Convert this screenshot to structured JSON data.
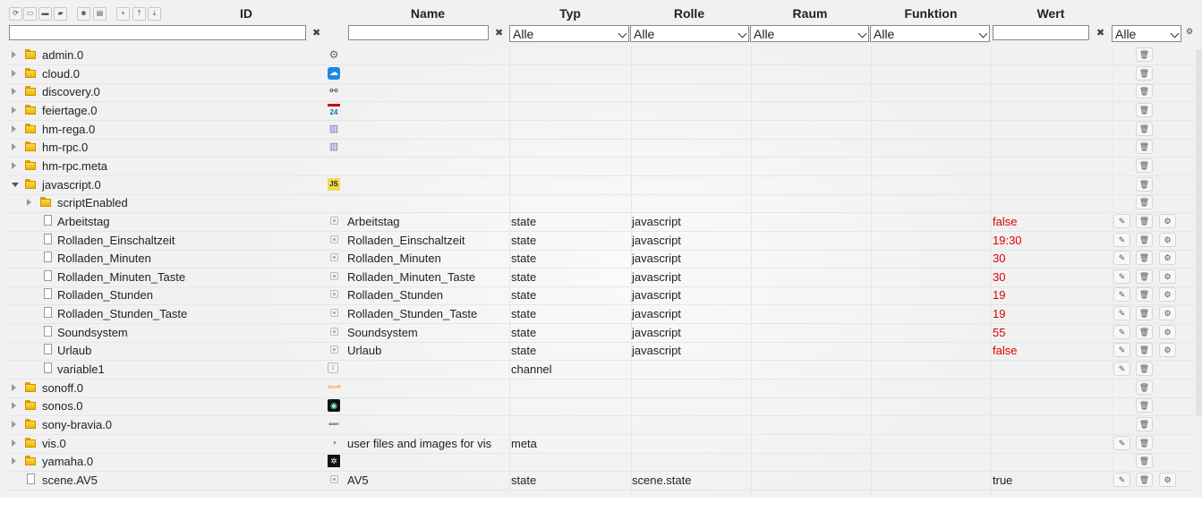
{
  "header": {
    "columns": {
      "id": "ID",
      "name": "Name",
      "typ": "Typ",
      "rolle": "Rolle",
      "raum": "Raum",
      "funktion": "Funktion",
      "wert": "Wert"
    },
    "toolbar_icons": [
      "refresh-icon",
      "collapse-icon",
      "folder-icon",
      "folder-open-icon",
      "user-icon",
      "list-icon",
      "add-icon",
      "upload-icon",
      "download-icon"
    ]
  },
  "filters": {
    "clear": "✖",
    "typ": "Alle",
    "rolle": "Alle",
    "raum": "Alle",
    "funktion": "Alle",
    "last": "Alle"
  },
  "rows": [
    {
      "id": "admin.0",
      "kind": "folder",
      "level": 0,
      "icon": "gear-icon"
    },
    {
      "id": "cloud.0",
      "kind": "folder",
      "level": 0,
      "icon": "cloud-icon"
    },
    {
      "id": "discovery.0",
      "kind": "folder",
      "level": 0,
      "icon": "binoculars-icon"
    },
    {
      "id": "feiertage.0",
      "kind": "folder",
      "level": 0,
      "icon": "calendar-icon"
    },
    {
      "id": "hm-rega.0",
      "kind": "folder",
      "level": 0,
      "icon": "homematic-icon"
    },
    {
      "id": "hm-rpc.0",
      "kind": "folder",
      "level": 0,
      "icon": "homematic-icon"
    },
    {
      "id": "hm-rpc.meta",
      "kind": "folder",
      "level": 0,
      "icon": ""
    },
    {
      "id": "javascript.0",
      "kind": "folder-open",
      "level": 0,
      "icon": "javascript-icon",
      "icon_text": "JS"
    },
    {
      "id": "scriptEnabled",
      "kind": "folder",
      "level": 1,
      "icon": ""
    },
    {
      "id": "Arbeitstag",
      "kind": "file",
      "level": 1,
      "name": "Arbeitstag",
      "typ": "state",
      "rolle": "javascript",
      "wert": "false",
      "actions": true
    },
    {
      "id": "Rolladen_Einschaltzeit",
      "kind": "file",
      "level": 1,
      "name": "Rolladen_Einschaltzeit",
      "typ": "state",
      "rolle": "javascript",
      "wert": "19:30",
      "actions": true
    },
    {
      "id": "Rolladen_Minuten",
      "kind": "file",
      "level": 1,
      "name": "Rolladen_Minuten",
      "typ": "state",
      "rolle": "javascript",
      "wert": "30",
      "actions": true
    },
    {
      "id": "Rolladen_Minuten_Taste",
      "kind": "file",
      "level": 1,
      "name": "Rolladen_Minuten_Taste",
      "typ": "state",
      "rolle": "javascript",
      "wert": "30",
      "actions": true
    },
    {
      "id": "Rolladen_Stunden",
      "kind": "file",
      "level": 1,
      "name": "Rolladen_Stunden",
      "typ": "state",
      "rolle": "javascript",
      "wert": "19",
      "actions": true
    },
    {
      "id": "Rolladen_Stunden_Taste",
      "kind": "file",
      "level": 1,
      "name": "Rolladen_Stunden_Taste",
      "typ": "state",
      "rolle": "javascript",
      "wert": "19",
      "actions": true
    },
    {
      "id": "Soundsystem",
      "kind": "file",
      "level": 1,
      "name": "Soundsystem",
      "typ": "state",
      "rolle": "javascript",
      "wert": "55",
      "actions": true
    },
    {
      "id": "Urlaub",
      "kind": "file",
      "level": 1,
      "name": "Urlaub",
      "typ": "state",
      "rolle": "javascript",
      "wert": "false",
      "actions": true
    },
    {
      "id": "variable1",
      "kind": "file",
      "level": 1,
      "typ": "channel",
      "icon": "info-icon",
      "actions2": true
    },
    {
      "id": "sonoff.0",
      "kind": "folder",
      "level": 0,
      "icon": "sonoff-icon",
      "icon_text": "Sonoff"
    },
    {
      "id": "sonos.0",
      "kind": "folder",
      "level": 0,
      "icon": "sonos-icon"
    },
    {
      "id": "sony-bravia.0",
      "kind": "folder",
      "level": 0,
      "icon": "sony-icon",
      "icon_text": "SONY"
    },
    {
      "id": "vis.0",
      "kind": "folder",
      "level": 0,
      "icon": "vis-icon",
      "name": "user files and images for vis",
      "typ": "meta",
      "actions2": true
    },
    {
      "id": "yamaha.0",
      "kind": "folder",
      "level": 0,
      "icon": "yamaha-icon"
    },
    {
      "id": "scene.AV5",
      "kind": "file",
      "level": 0,
      "name": "AV5",
      "typ": "state",
      "rolle": "scene.state",
      "wert": "true",
      "wert_color": "normal",
      "actions": true
    }
  ],
  "colors": {
    "value_red": "#dd0000",
    "folder": "#f0b400"
  }
}
